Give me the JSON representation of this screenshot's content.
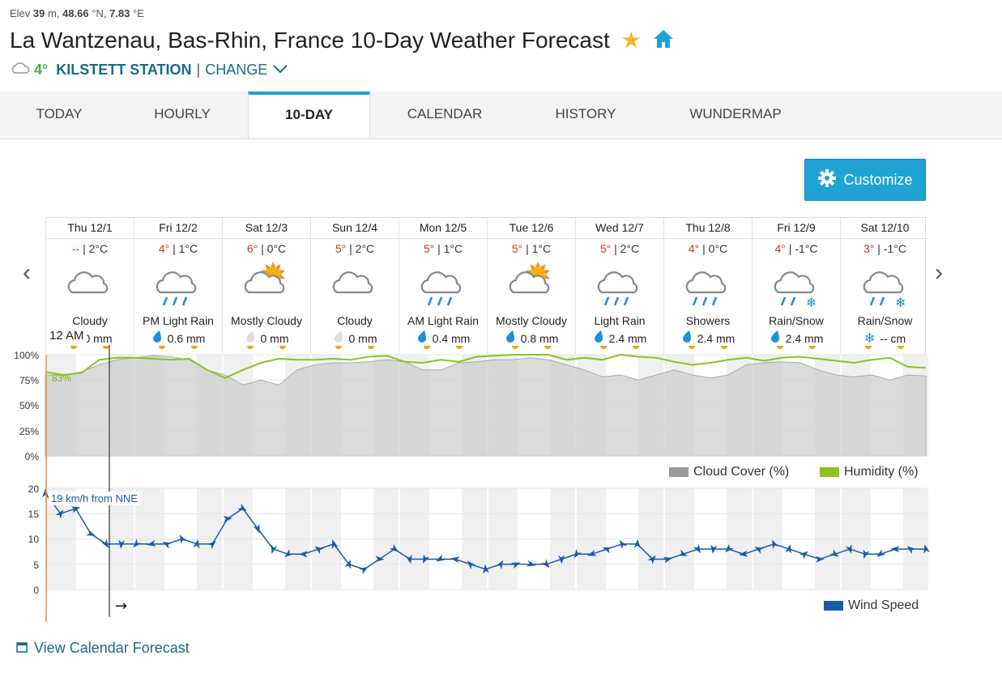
{
  "header": {
    "elev_label": "Elev",
    "elev_value": "39",
    "elev_unit": "m,",
    "lat": "48.66",
    "lat_unit": "°N,",
    "lon": "7.83",
    "lon_unit": "°E",
    "title": "La Wantzenau, Bas-Rhin, France 10-Day Weather Forecast",
    "star": "★",
    "station_temp": "4°",
    "station_name": "KILSTETT STATION",
    "separator": "|",
    "change_label": "CHANGE"
  },
  "tabs": [
    {
      "label": "TODAY",
      "active": false
    },
    {
      "label": "HOURLY",
      "active": false
    },
    {
      "label": "10-DAY",
      "active": true
    },
    {
      "label": "CALENDAR",
      "active": false
    },
    {
      "label": "HISTORY",
      "active": false
    },
    {
      "label": "WUNDERMAP",
      "active": false
    }
  ],
  "customize_label": "Customize",
  "nav": {
    "prev": "‹",
    "next": "›"
  },
  "days": [
    {
      "name": "Thu 12/1",
      "hi": "--",
      "lo": "2°C",
      "icon": "cloudy-icon",
      "cond": "Cloudy",
      "precip_type": "none",
      "precip": "0 mm"
    },
    {
      "name": "Fri 12/2",
      "hi": "4°",
      "lo": "1°C",
      "icon": "rain-icon",
      "cond": "PM Light Rain",
      "precip_type": "rain",
      "precip": "0.6 mm"
    },
    {
      "name": "Sat 12/3",
      "hi": "6°",
      "lo": "0°C",
      "icon": "mostly-cloudy-icon",
      "cond": "Mostly Cloudy",
      "precip_type": "none",
      "precip": "0 mm"
    },
    {
      "name": "Sun 12/4",
      "hi": "5°",
      "lo": "2°C",
      "icon": "cloudy-icon",
      "cond": "Cloudy",
      "precip_type": "none",
      "precip": "0 mm"
    },
    {
      "name": "Mon 12/5",
      "hi": "5°",
      "lo": "1°C",
      "icon": "rain-icon",
      "cond": "AM Light Rain",
      "precip_type": "rain",
      "precip": "0.4 mm"
    },
    {
      "name": "Tue 12/6",
      "hi": "5°",
      "lo": "1°C",
      "icon": "mostly-cloudy-icon",
      "cond": "Mostly Cloudy",
      "precip_type": "rain",
      "precip": "0.8 mm"
    },
    {
      "name": "Wed 12/7",
      "hi": "5°",
      "lo": "2°C",
      "icon": "rain-icon",
      "cond": "Light Rain",
      "precip_type": "rain",
      "precip": "2.4 mm"
    },
    {
      "name": "Thu 12/8",
      "hi": "4°",
      "lo": "0°C",
      "icon": "rain-icon",
      "cond": "Showers",
      "precip_type": "rain",
      "precip": "2.4 mm"
    },
    {
      "name": "Fri 12/9",
      "hi": "4°",
      "lo": "-1°C",
      "icon": "rain-snow-icon",
      "cond": "Rain/Snow",
      "precip_type": "rain",
      "precip": "2.4 mm"
    },
    {
      "name": "Sat 12/10",
      "hi": "3°",
      "lo": "-1°C",
      "icon": "rain-snow-icon",
      "cond": "Rain/Snow",
      "precip_type": "snow",
      "precip": "-- cm"
    }
  ],
  "current_time_label": "12 AM",
  "chart_data": [
    {
      "type": "area",
      "series": [
        {
          "name": "Cloud Cover (%)",
          "color": "#bbbbbb"
        },
        {
          "name": "Humidity (%)",
          "color": "#8dc21f"
        }
      ],
      "x_days": [
        "Thu 12/1",
        "Fri 12/2",
        "Sat 12/3",
        "Sun 12/4",
        "Mon 12/5",
        "Tue 12/6",
        "Wed 12/7",
        "Thu 12/8",
        "Fri 12/9",
        "Sat 12/10"
      ],
      "cloud_cover": [
        80,
        80,
        83,
        90,
        95,
        97,
        99,
        98,
        95,
        85,
        80,
        70,
        75,
        70,
        85,
        90,
        92,
        92,
        93,
        95,
        93,
        85,
        85,
        92,
        93,
        95,
        95,
        97,
        95,
        90,
        85,
        78,
        80,
        75,
        80,
        85,
        80,
        77,
        80,
        90,
        92,
        93,
        92,
        85,
        80,
        78,
        80,
        75,
        80,
        79
      ],
      "humidity": [
        83,
        80,
        82,
        95,
        97,
        97,
        96,
        95,
        96,
        85,
        77,
        85,
        92,
        96,
        95,
        95,
        96,
        95,
        98,
        99,
        93,
        92,
        95,
        93,
        98,
        99,
        100,
        100,
        100,
        95,
        97,
        95,
        100,
        98,
        97,
        93,
        90,
        92,
        95,
        97,
        94,
        97,
        98,
        96,
        94,
        92,
        95,
        97,
        88,
        87
      ],
      "y_ticks": [
        "100%",
        "75%",
        "50%",
        "25%",
        "0%"
      ],
      "ylim": [
        0,
        100
      ],
      "annotation": "83%"
    },
    {
      "type": "line",
      "series": [
        {
          "name": "Wind Speed",
          "color": "#1a5aa8"
        }
      ],
      "wind": [
        19,
        15,
        16,
        11,
        9,
        9,
        9,
        9,
        9,
        10,
        9,
        9,
        14,
        16,
        12,
        8,
        7,
        7,
        8,
        9,
        5,
        4,
        6,
        8,
        6,
        6,
        6,
        6,
        5,
        4,
        5,
        5,
        5,
        5,
        6,
        7,
        7,
        8,
        9,
        9,
        6,
        6,
        7,
        8,
        8,
        8,
        7,
        8,
        9,
        8,
        7,
        6,
        7,
        8,
        7,
        7,
        8,
        8,
        8
      ],
      "y_ticks": [
        "20",
        "15",
        "10",
        "5",
        "0"
      ],
      "ylim": [
        0,
        20
      ],
      "tooltip": "19 km/h from NNE"
    }
  ],
  "legend": {
    "cloud": "Cloud Cover (%)",
    "humidity": "Humidity (%)",
    "wind": "Wind Speed"
  },
  "calendar_link": "View Calendar Forecast"
}
